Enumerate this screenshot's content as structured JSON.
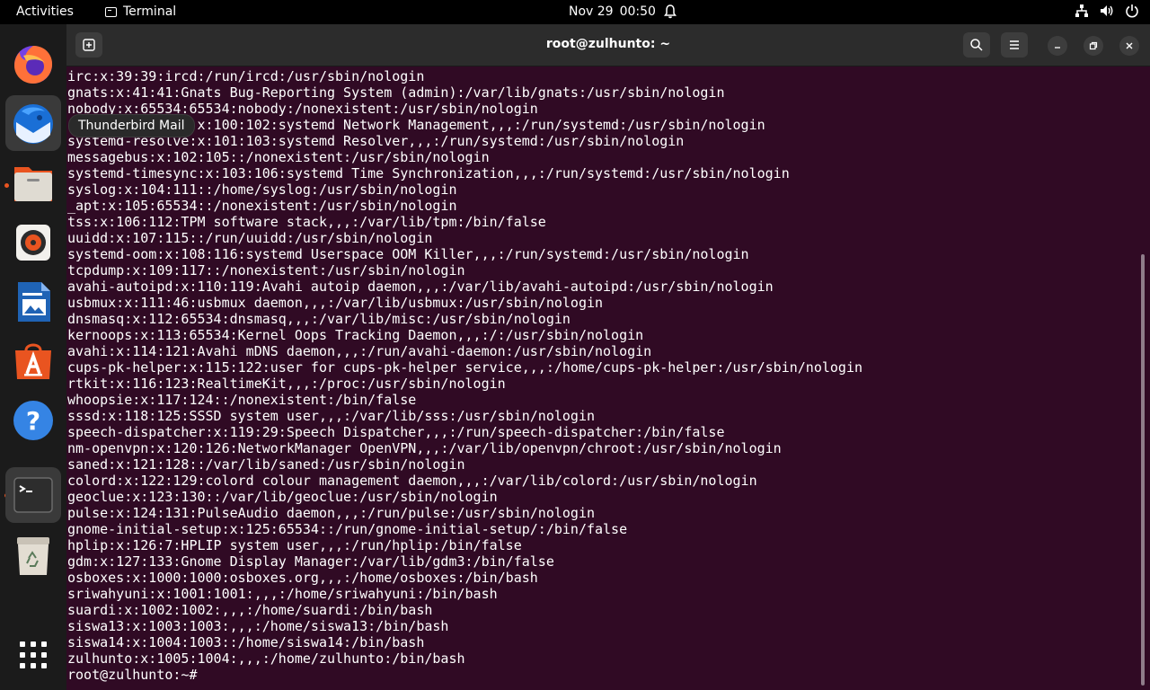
{
  "topbar": {
    "activities": "Activities",
    "app_name": "Terminal",
    "date": "Nov 29",
    "time": "00:50"
  },
  "dock": {
    "tooltip": "Thunderbird Mail",
    "items": [
      "firefox-icon",
      "thunderbird-icon",
      "files-icon",
      "rhythmbox-icon",
      "libreoffice-writer-icon",
      "app-center-icon",
      "help-icon",
      "terminal-icon",
      "trash-icon",
      "show-apps-icon"
    ]
  },
  "window": {
    "title": "root@zulhunto: ~"
  },
  "terminal": {
    "lines": [
      "irc:x:39:39:ircd:/run/ircd:/usr/sbin/nologin",
      "gnats:x:41:41:Gnats Bug-Reporting System (admin):/var/lib/gnats:/usr/sbin/nologin",
      "nobody:x:65534:65534:nobody:/nonexistent:/usr/sbin/nologin",
      "systemd-network:x:100:102:systemd Network Management,,,:/run/systemd:/usr/sbin/nologin",
      "systemd-resolve:x:101:103:systemd Resolver,,,:/run/systemd:/usr/sbin/nologin",
      "messagebus:x:102:105::/nonexistent:/usr/sbin/nologin",
      "systemd-timesync:x:103:106:systemd Time Synchronization,,,:/run/systemd:/usr/sbin/nologin",
      "syslog:x:104:111::/home/syslog:/usr/sbin/nologin",
      "_apt:x:105:65534::/nonexistent:/usr/sbin/nologin",
      "tss:x:106:112:TPM software stack,,,:/var/lib/tpm:/bin/false",
      "uuidd:x:107:115::/run/uuidd:/usr/sbin/nologin",
      "systemd-oom:x:108:116:systemd Userspace OOM Killer,,,:/run/systemd:/usr/sbin/nologin",
      "tcpdump:x:109:117::/nonexistent:/usr/sbin/nologin",
      "avahi-autoipd:x:110:119:Avahi autoip daemon,,,:/var/lib/avahi-autoipd:/usr/sbin/nologin",
      "usbmux:x:111:46:usbmux daemon,,,:/var/lib/usbmux:/usr/sbin/nologin",
      "dnsmasq:x:112:65534:dnsmasq,,,:/var/lib/misc:/usr/sbin/nologin",
      "kernoops:x:113:65534:Kernel Oops Tracking Daemon,,,:/:/usr/sbin/nologin",
      "avahi:x:114:121:Avahi mDNS daemon,,,:/run/avahi-daemon:/usr/sbin/nologin",
      "cups-pk-helper:x:115:122:user for cups-pk-helper service,,,:/home/cups-pk-helper:/usr/sbin/nologin",
      "rtkit:x:116:123:RealtimeKit,,,:/proc:/usr/sbin/nologin",
      "whoopsie:x:117:124::/nonexistent:/bin/false",
      "sssd:x:118:125:SSSD system user,,,:/var/lib/sss:/usr/sbin/nologin",
      "speech-dispatcher:x:119:29:Speech Dispatcher,,,:/run/speech-dispatcher:/bin/false",
      "nm-openvpn:x:120:126:NetworkManager OpenVPN,,,:/var/lib/openvpn/chroot:/usr/sbin/nologin",
      "saned:x:121:128::/var/lib/saned:/usr/sbin/nologin",
      "colord:x:122:129:colord colour management daemon,,,:/var/lib/colord:/usr/sbin/nologin",
      "geoclue:x:123:130::/var/lib/geoclue:/usr/sbin/nologin",
      "pulse:x:124:131:PulseAudio daemon,,,:/run/pulse:/usr/sbin/nologin",
      "gnome-initial-setup:x:125:65534::/run/gnome-initial-setup/:/bin/false",
      "hplip:x:126:7:HPLIP system user,,,:/run/hplip:/bin/false",
      "gdm:x:127:133:Gnome Display Manager:/var/lib/gdm3:/bin/false",
      "osboxes:x:1000:1000:osboxes.org,,,:/home/osboxes:/bin/bash",
      "sriwahyuni:x:1001:1001:,,,:/home/sriwahyuni:/bin/bash",
      "suardi:x:1002:1002:,,,:/home/suardi:/bin/bash",
      "siswa13:x:1003:1003:,,,:/home/siswa13:/bin/bash",
      "siswa14:x:1004:1003::/home/siswa14:/bin/bash",
      "zulhunto:x:1005:1004:,,,:/home/zulhunto:/bin/bash",
      "root@zulhunto:~#"
    ]
  },
  "colors": {
    "terminal_bg": "#300a24",
    "accent": "#e95420"
  }
}
